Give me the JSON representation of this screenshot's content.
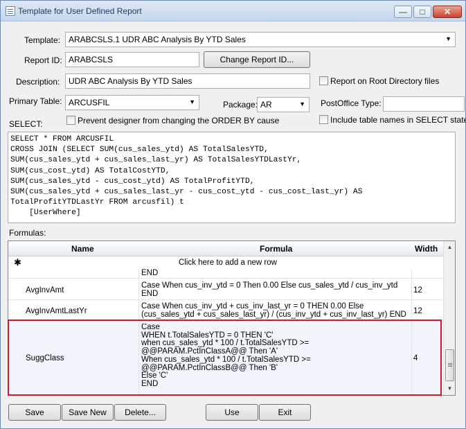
{
  "window": {
    "title": "Template for User Defined Report",
    "min_glyph": "—",
    "max_glyph": "□",
    "close_glyph": "✕"
  },
  "form": {
    "template_label": "Template:",
    "template_value": "ARABCSLS.1  UDR ABC Analysis By YTD Sales",
    "report_id_label": "Report ID:",
    "report_id_value": "ARABCSLS",
    "change_report_id_button": "Change Report ID...",
    "description_label": "Description:",
    "description_value": "UDR ABC Analysis By YTD Sales",
    "report_on_root_label": "Report on Root Directory files",
    "primary_table_label": "Primary Table:",
    "primary_table_value": "ARCUSFIL",
    "package_label": "Package:",
    "package_value": "AR",
    "postoffice_label": "PostOffice Type:",
    "postoffice_value": "",
    "select_label": "SELECT:",
    "prevent_order_by_label": "Prevent designer from changing the ORDER BY cause",
    "include_table_names_label": "Include table names in SELECT stateme",
    "sql_text": "SELECT * FROM ARCUSFIL\nCROSS JOIN (SELECT SUM(cus_sales_ytd) AS TotalSalesYTD,\nSUM(cus_sales_ytd + cus_sales_last_yr) AS TotalSalesYTDLastYr,\nSUM(cus_cost_ytd) AS TotalCostYTD,\nSUM(cus_sales_ytd - cus_cost_ytd) AS TotalProfitYTD,\nSUM(cus_sales_ytd + cus_sales_last_yr - cus_cost_ytd - cus_cost_last_yr) AS\nTotalProfitYTDLastYr FROM arcusfil) t\n    [UserWhere]",
    "formulas_label": "Formulas:"
  },
  "grid": {
    "columns": [
      "Name",
      "Formula",
      "Width"
    ],
    "new_row_marker": "✱",
    "new_row_text": "Click here to add a new row",
    "rows": [
      {
        "name": "",
        "formula": "END",
        "width": ""
      },
      {
        "name": "AvgInvAmt",
        "formula": "Case When cus_inv_ytd = 0 Then 0.00 Else cus_sales_ytd / cus_inv_ytd\nEND",
        "width": "12"
      },
      {
        "name": "AvgInvAmtLastYr",
        "formula": "Case When cus_inv_ytd + cus_inv_last_yr = 0 THEN 0.00 Else\n(cus_sales_ytd + cus_sales_last_yr) / (cus_inv_ytd + cus_inv_last_yr) END",
        "width": "12"
      },
      {
        "name": "SuggClass",
        "formula": "Case\nWHEN t.TotalSalesYTD = 0 THEN 'C'\nwhen cus_sales_ytd * 100 / t.TotalSalesYTD >=\n@@PARAM.PctInClassA@@ Then 'A'\nWhen cus_sales_ytd * 100 / t.TotalSalesYTD >=\n@@PARAM.PctInClassB@@ Then 'B'\nElse 'C'\nEND",
        "width": "4"
      }
    ]
  },
  "buttons": {
    "save": "Save",
    "save_new": "Save New",
    "delete": "Delete...",
    "use": "Use",
    "exit": "Exit"
  },
  "colors": {
    "highlight_border": "#d2192c",
    "title_text": "#1e395b"
  }
}
